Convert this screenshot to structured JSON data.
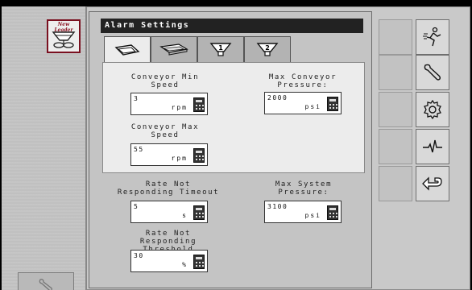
{
  "logo": {
    "brand_text": "New Leader"
  },
  "screen": {
    "title": "Alarm Settings"
  },
  "tabs": [
    {
      "id": "spinner",
      "icon": "spinner-icon",
      "active": true
    },
    {
      "id": "conveyor",
      "icon": "conveyor-icon",
      "active": false
    },
    {
      "id": "bin-1",
      "icon": "bin-1-icon",
      "label": "1",
      "active": false
    },
    {
      "id": "bin-2",
      "icon": "bin-2-icon",
      "label": "2",
      "active": false
    }
  ],
  "fields": {
    "conveyor_min_speed": {
      "label": "Conveyor Min Speed",
      "value": "3",
      "unit": "rpm"
    },
    "max_conveyor_pressure": {
      "label": "Max Conveyor Pressure:",
      "value": "2000",
      "unit": "psi"
    },
    "conveyor_max_speed": {
      "label": "Conveyor Max Speed",
      "value": "55",
      "unit": "rpm"
    },
    "rate_not_responding_timeout": {
      "label": "Rate Not Responding Timeout",
      "value": "5",
      "unit": "s"
    },
    "max_system_pressure": {
      "label": "Max System Pressure:",
      "value": "3100",
      "unit": "psi"
    },
    "rate_not_responding_threshold": {
      "label": "Rate Not Responding Threshold",
      "value": "30",
      "unit": "%"
    }
  },
  "side_buttons": [
    "run-icon",
    "wrench-icon",
    "gear-icon",
    "diagnostics-icon",
    "back-icon"
  ],
  "colors": {
    "title_bg": "#222222",
    "logo_border": "#7a1020",
    "panel_bg": "#ececec"
  }
}
